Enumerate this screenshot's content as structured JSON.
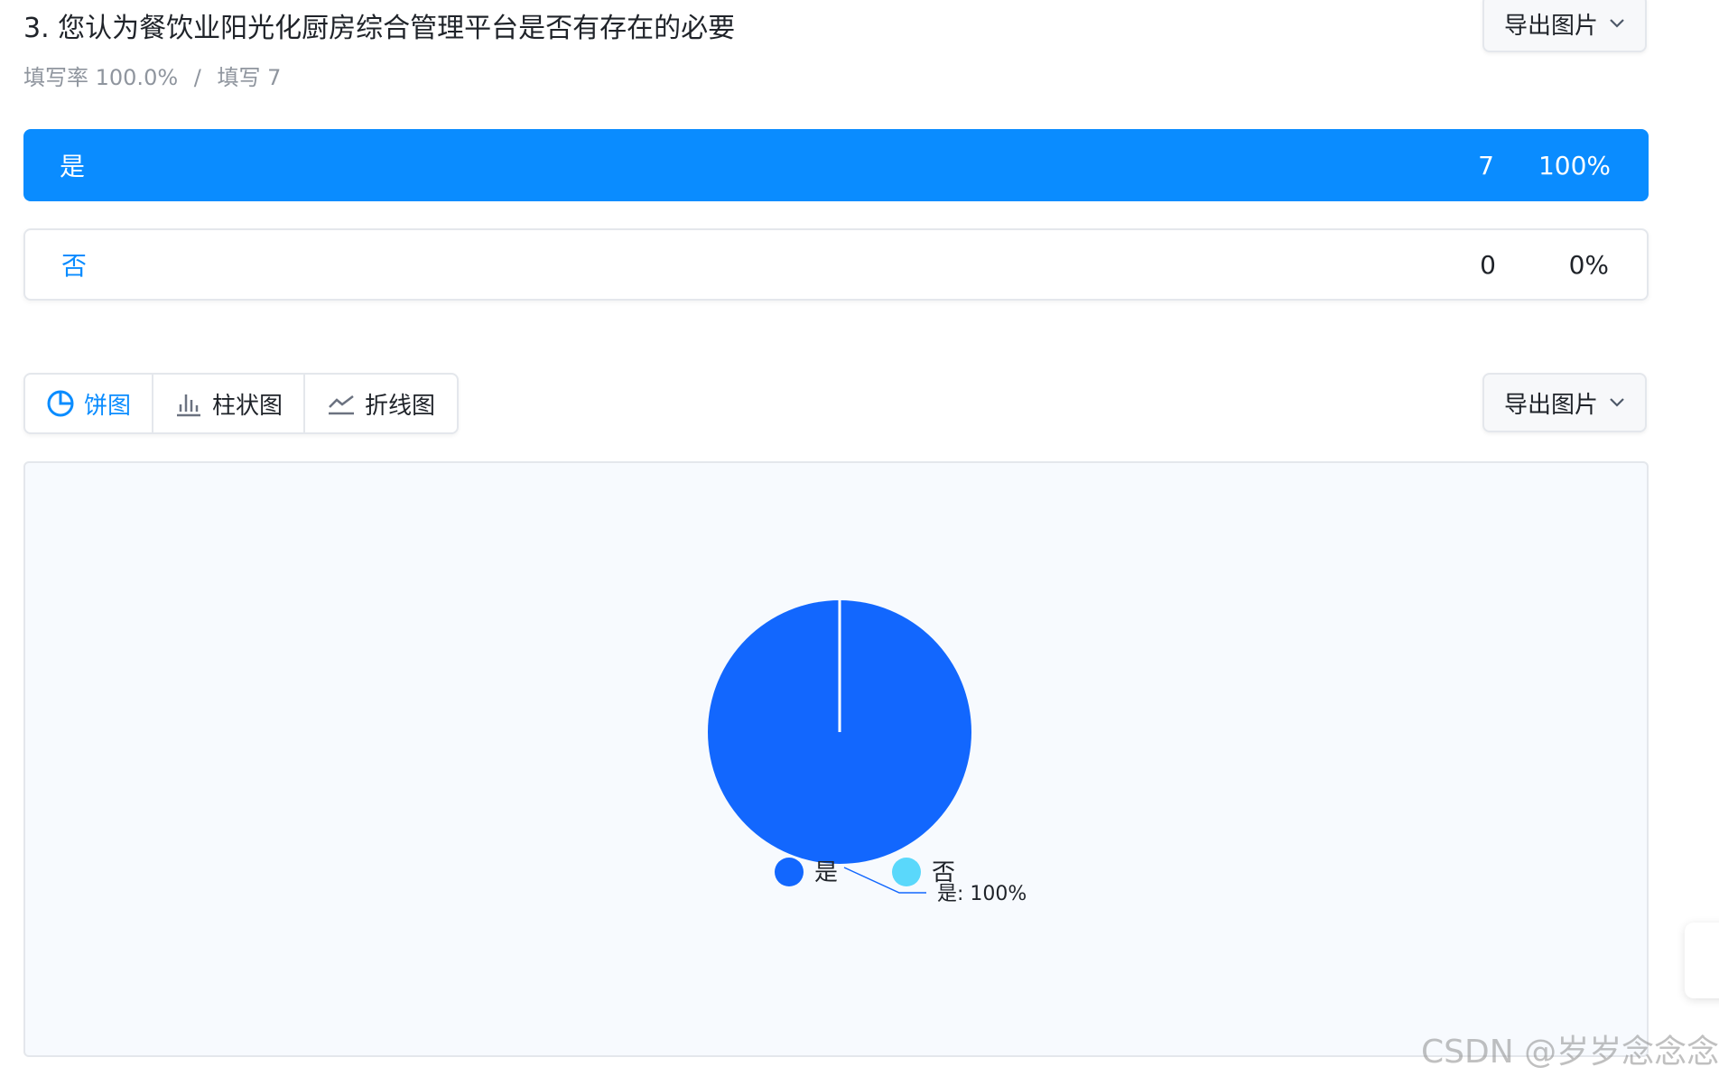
{
  "question": {
    "title": "3. 您认为餐饮业阳光化厨房综合管理平台是否有存在的必要",
    "fill_rate_label": "填写率 100.0%",
    "separator": "/",
    "fill_count_label": "填写 7"
  },
  "export": {
    "label": "导出图片"
  },
  "options": [
    {
      "label": "是",
      "count": "7",
      "percent": "100%",
      "selected": true
    },
    {
      "label": "否",
      "count": "0",
      "percent": "0%",
      "selected": false
    }
  ],
  "chart_tabs": [
    {
      "label": "饼图",
      "icon": "pie-chart-icon",
      "active": true
    },
    {
      "label": "柱状图",
      "icon": "bar-chart-icon",
      "active": false
    },
    {
      "label": "折线图",
      "icon": "line-chart-icon",
      "active": false
    }
  ],
  "chart_data": {
    "type": "pie",
    "categories": [
      "是",
      "否"
    ],
    "values": [
      7,
      0
    ],
    "colors": [
      "#1267fe",
      "#5ad8fb"
    ],
    "slice_label": "是: 100%",
    "legend_position": "bottom"
  },
  "watermark": "CSDN @岁岁念念念"
}
